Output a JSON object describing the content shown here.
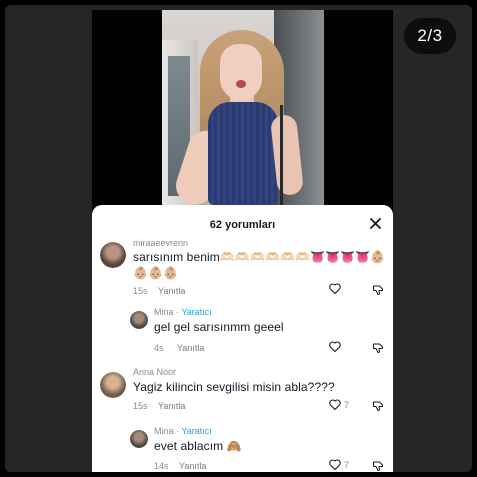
{
  "viewer": {
    "counter": "2/3"
  },
  "sheet": {
    "title": "62 yorumları"
  },
  "comments": [
    {
      "username": "miraaeevrenn",
      "text_line1": "sarısınım benim🫶🏻🫶🏻🫶🏻🫶🏻🫶🏻🫶🏻👅👅👅👅👶🏼",
      "text_line2": "👶🏼👶🏼👶🏼",
      "age": "15s",
      "reply": "Yanıtla",
      "likes": "",
      "avatar_color": "#5a4338"
    },
    {
      "username": "Mina",
      "separator": " · ",
      "badge": "Yaratıcı",
      "text_line1": "gel gel sarısınmm geeel",
      "age": "4s",
      "reply": "Yanıtla",
      "likes": "",
      "avatar_color": "#4b4540"
    },
    {
      "username": "Anna Noor",
      "text_line1": "Yagiz kilincin sevgilisi misin abla????",
      "age": "15s",
      "reply": "Yanıtla",
      "likes": "7",
      "avatar_color": "#6b5a4a"
    },
    {
      "username": "Mina",
      "separator": " · ",
      "badge": "Yaratıcı",
      "text_line1": "evet ablacım 🙈",
      "age": "14s",
      "reply": "Yanıtla",
      "likes": "7",
      "avatar_color": "#4b4540"
    }
  ],
  "icons": {
    "close": "close-icon",
    "like": "heart-outline-icon",
    "dislike": "thumbs-down-icon"
  }
}
